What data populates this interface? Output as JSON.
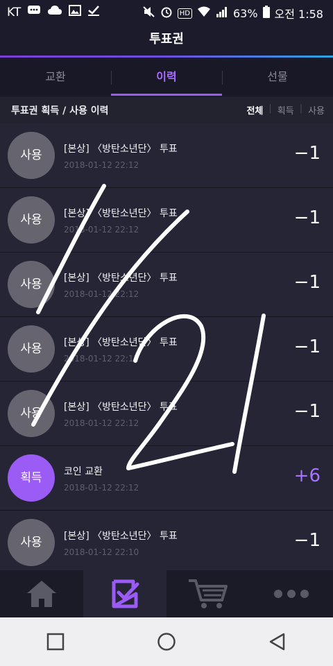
{
  "status_bar": {
    "carrier": "KT",
    "battery": "63%",
    "time": "오전 1:58",
    "hd_label": "HD"
  },
  "header": {
    "title": "투표권"
  },
  "tabs": [
    {
      "label": "교환",
      "active": false
    },
    {
      "label": "이력",
      "active": true
    },
    {
      "label": "선물",
      "active": false
    }
  ],
  "subheader": {
    "title": "투표권 획득 / 사용 이력",
    "filters": [
      "전체",
      "획득",
      "사용"
    ],
    "selected_filter": "전체"
  },
  "history": [
    {
      "badge": "사용",
      "title": "[본상] 〈방탄소년단〉 투표",
      "date": "2018-01-12 22:12",
      "amount": "−1",
      "type": "use"
    },
    {
      "badge": "사용",
      "title": "[본상] 〈방탄소년단〉 투표",
      "date": "2018-01-12 22:12",
      "amount": "−1",
      "type": "use"
    },
    {
      "badge": "사용",
      "title": "[본상] 〈방탄소년단〉 투표",
      "date": "2018-01-12 22:12",
      "amount": "−1",
      "type": "use"
    },
    {
      "badge": "사용",
      "title": "[본상] 〈방탄소년단〉 투표",
      "date": "2018-01-12 22:12",
      "amount": "−1",
      "type": "use"
    },
    {
      "badge": "사용",
      "title": "[본상] 〈방탄소년단〉 투표",
      "date": "2018-01-12 22:12",
      "amount": "−1",
      "type": "use"
    },
    {
      "badge": "획득",
      "title": "코인 교환",
      "date": "2018-01-12 22:12",
      "amount": "+6",
      "type": "gain"
    },
    {
      "badge": "사용",
      "title": "[본상] 〈방탄소년단〉 투표",
      "date": "2018-01-12 22:10",
      "amount": "−1",
      "type": "use"
    }
  ],
  "bottom_nav": [
    {
      "icon": "home-icon",
      "active": false
    },
    {
      "icon": "vote-check-icon",
      "active": true
    },
    {
      "icon": "cart-icon",
      "active": false
    },
    {
      "icon": "more-icon",
      "active": false
    }
  ],
  "colors": {
    "accent": "#9b5cf6",
    "background": "#1c1b2b",
    "row": "#262536",
    "use_badge": "#66646f"
  }
}
